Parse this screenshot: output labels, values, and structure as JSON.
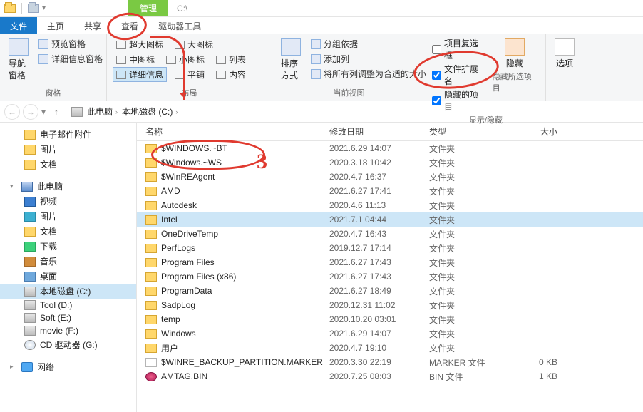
{
  "titlebar": {
    "manage_label": "管理",
    "path": "C:\\"
  },
  "tabs": {
    "file": "文件",
    "home": "主页",
    "share": "共享",
    "view": "查看",
    "drivetools": "驱动器工具"
  },
  "ribbon": {
    "panes_group": "窗格",
    "nav_pane": "导航窗格",
    "preview_pane": "预览窗格",
    "details_pane": "详细信息窗格",
    "layout_group": "布局",
    "xl_icons": "超大图标",
    "l_icons": "大图标",
    "m_icons": "中图标",
    "s_icons": "小图标",
    "list": "列表",
    "details": "详细信息",
    "tiles": "平铺",
    "content": "内容",
    "current_view_group": "当前视图",
    "sort_by": "排序方式",
    "group_by": "分组依据",
    "add_columns": "添加列",
    "size_all": "将所有列调整为合适的大小",
    "showhide_group": "显示/隐藏",
    "item_checkboxes": "项目复选框",
    "file_ext": "文件扩展名",
    "hidden_items": "隐藏的项目",
    "hide_selected": "隐藏所选项目",
    "hide_btn": "隐藏",
    "options": "选项"
  },
  "breadcrumb": {
    "this_pc": "此电脑",
    "drive": "本地磁盘 (C:)"
  },
  "nav": {
    "email_attach": "电子邮件附件",
    "pictures": "图片",
    "documents": "文档",
    "this_pc": "此电脑",
    "videos": "视频",
    "pictures2": "图片",
    "documents2": "文档",
    "downloads": "下载",
    "music": "音乐",
    "desktop": "桌面",
    "drive_c": "本地磁盘 (C:)",
    "tool_d": "Tool (D:)",
    "soft_e": "Soft (E:)",
    "movie_f": "movie (F:)",
    "cd_g": "CD 驱动器 (G:)",
    "network": "网络"
  },
  "columns": {
    "name": "名称",
    "date": "修改日期",
    "type": "类型",
    "size": "大小"
  },
  "rows": [
    {
      "name": "$WINDOWS.~BT",
      "date": "2021.6.29 14:07",
      "type": "文件夹",
      "size": "",
      "icon": "fold",
      "sel": false
    },
    {
      "name": "$Windows.~WS",
      "date": "2020.3.18 10:42",
      "type": "文件夹",
      "size": "",
      "icon": "fold",
      "sel": false
    },
    {
      "name": "$WinREAgent",
      "date": "2020.4.7 16:37",
      "type": "文件夹",
      "size": "",
      "icon": "fold",
      "sel": false
    },
    {
      "name": "AMD",
      "date": "2021.6.27 17:41",
      "type": "文件夹",
      "size": "",
      "icon": "fold",
      "sel": false
    },
    {
      "name": "Autodesk",
      "date": "2020.4.6 11:13",
      "type": "文件夹",
      "size": "",
      "icon": "fold",
      "sel": false
    },
    {
      "name": "Intel",
      "date": "2021.7.1 04:44",
      "type": "文件夹",
      "size": "",
      "icon": "fold",
      "sel": true
    },
    {
      "name": "OneDriveTemp",
      "date": "2020.4.7 16:43",
      "type": "文件夹",
      "size": "",
      "icon": "fold",
      "sel": false
    },
    {
      "name": "PerfLogs",
      "date": "2019.12.7 17:14",
      "type": "文件夹",
      "size": "",
      "icon": "fold",
      "sel": false
    },
    {
      "name": "Program Files",
      "date": "2021.6.27 17:43",
      "type": "文件夹",
      "size": "",
      "icon": "fold",
      "sel": false
    },
    {
      "name": "Program Files (x86)",
      "date": "2021.6.27 17:43",
      "type": "文件夹",
      "size": "",
      "icon": "fold",
      "sel": false
    },
    {
      "name": "ProgramData",
      "date": "2021.6.27 18:49",
      "type": "文件夹",
      "size": "",
      "icon": "fold",
      "sel": false
    },
    {
      "name": "SadpLog",
      "date": "2020.12.31 11:02",
      "type": "文件夹",
      "size": "",
      "icon": "fold",
      "sel": false
    },
    {
      "name": "temp",
      "date": "2020.10.20 03:01",
      "type": "文件夹",
      "size": "",
      "icon": "fold",
      "sel": false
    },
    {
      "name": "Windows",
      "date": "2021.6.29 14:07",
      "type": "文件夹",
      "size": "",
      "icon": "fold",
      "sel": false
    },
    {
      "name": "用户",
      "date": "2020.4.7 19:10",
      "type": "文件夹",
      "size": "",
      "icon": "fold",
      "sel": false
    },
    {
      "name": "$WINRE_BACKUP_PARTITION.MARKER",
      "date": "2020.3.30 22:19",
      "type": "MARKER 文件",
      "size": "0 KB",
      "icon": "file",
      "sel": false
    },
    {
      "name": "AMTAG.BIN",
      "date": "2020.7.25 08:03",
      "type": "BIN 文件",
      "size": "1 KB",
      "icon": "bin",
      "sel": false
    }
  ],
  "annotation": {
    "number": "3"
  }
}
